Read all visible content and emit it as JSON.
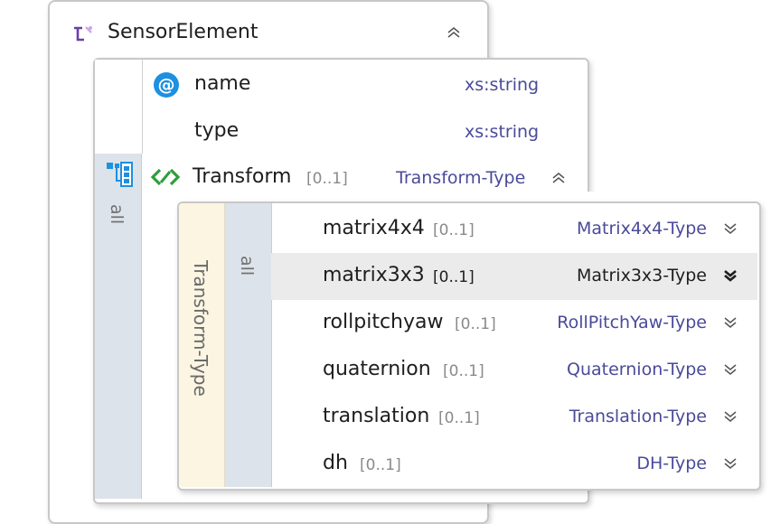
{
  "sensor_element": {
    "title": "SensorElement",
    "icon": "element-icon"
  },
  "attributes": [
    {
      "name": "name",
      "type": "xs:string",
      "icon": "at-attribute-icon"
    },
    {
      "name": "type",
      "type": "xs:string"
    }
  ],
  "outer_group": {
    "label": "all",
    "icon": "all-group-icon"
  },
  "transform": {
    "name": "Transform",
    "cardinality": "[0..1]",
    "type": "Transform-Type",
    "icon": "element-reference-icon"
  },
  "transform_type": {
    "label": "Transform-Type",
    "group_label": "all",
    "rows": [
      {
        "name": "matrix4x4",
        "cardinality": "[0..1]",
        "type": "Matrix4x4-Type",
        "selected": false
      },
      {
        "name": "matrix3x3",
        "cardinality": "[0..1]",
        "type": "Matrix3x3-Type",
        "selected": true
      },
      {
        "name": "rollpitchyaw",
        "cardinality": "[0..1]",
        "type": "RollPitchYaw-Type",
        "selected": false
      },
      {
        "name": "quaternion",
        "cardinality": "[0..1]",
        "type": "Quaternion-Type",
        "selected": false
      },
      {
        "name": "translation",
        "cardinality": "[0..1]",
        "type": "Translation-Type",
        "selected": false
      },
      {
        "name": "dh",
        "cardinality": "[0..1]",
        "type": "DH-Type",
        "selected": false
      }
    ]
  },
  "colors": {
    "type_text": "#4a4a9a",
    "accent_purple": "#6a3fa8",
    "green_icon": "#2e9e3a",
    "blue_icon": "#1e90e0",
    "group_bar": "#dde3ea",
    "type_bar": "#fbf5e2"
  }
}
